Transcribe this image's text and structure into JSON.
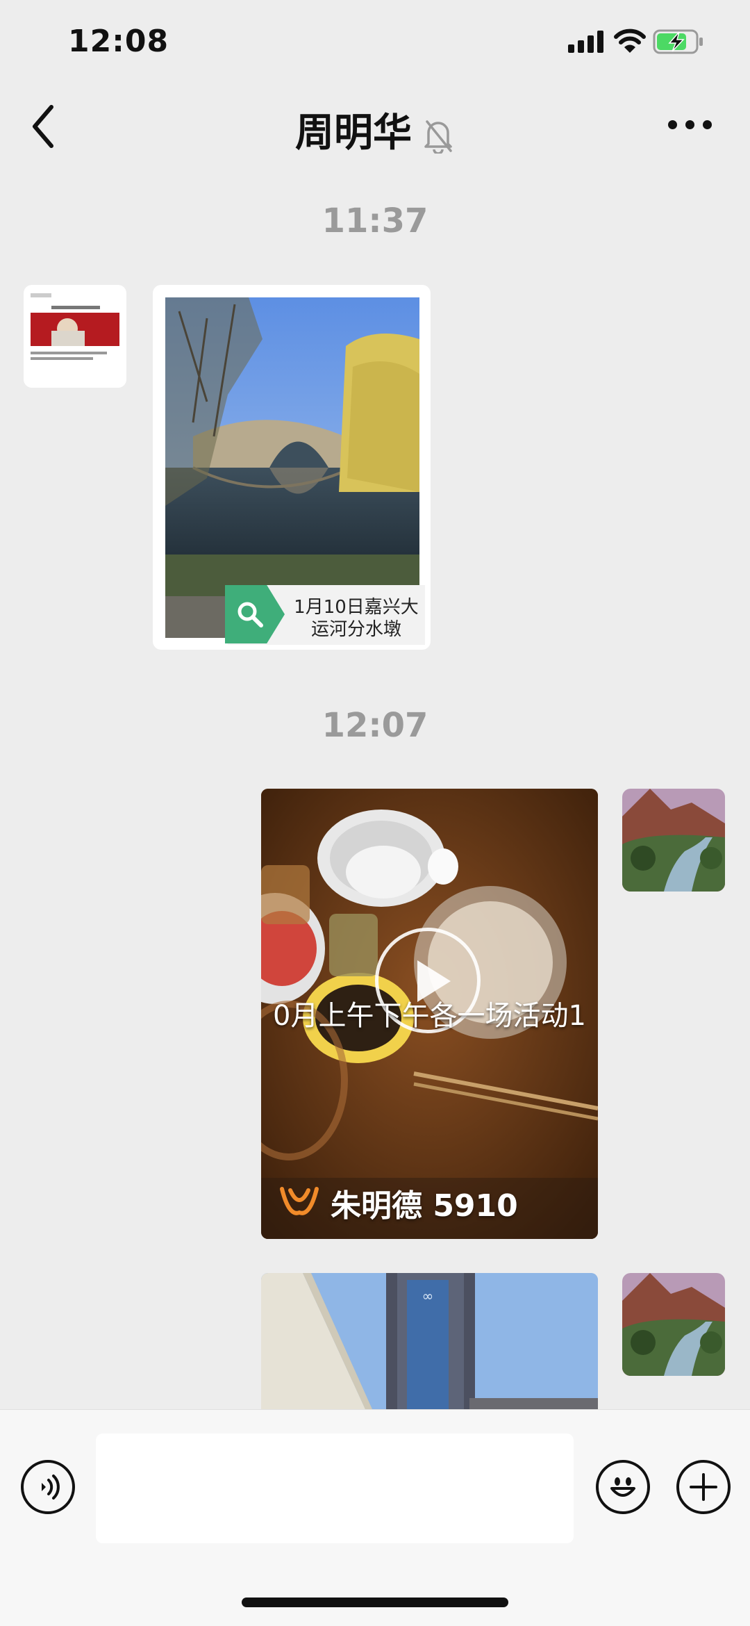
{
  "status_bar": {
    "time": "12:08",
    "signal_icon": "signal-bars-icon",
    "wifi_icon": "wifi-icon",
    "battery_icon": "battery-charging-icon",
    "battery_color": "#4cd964"
  },
  "header": {
    "back_icon": "chevron-left-icon",
    "title": "周明华",
    "mute_icon": "bell-slash-icon",
    "more_icon": "more-dots-icon"
  },
  "messages": {
    "time_1": "11:37",
    "received_image_caption": "1月10日嘉兴大运河分水墩",
    "received_caption_line1": "1月10日嘉兴大",
    "received_caption_line2": "运河分水墩",
    "search_icon": "search-icon",
    "time_2": "12:07",
    "video_overlay_text": "0月上午下午各一场活动1",
    "video_watermark": "朱明德 5910",
    "play_icon": "play-icon"
  },
  "input_bar": {
    "voice_icon": "voice-icon",
    "emoji_icon": "emoji-icon",
    "plus_icon": "plus-icon",
    "text_value": ""
  },
  "colors": {
    "background": "#ededed",
    "search_badge": "#3fae7a",
    "time_separator": "#9a9a9a"
  }
}
